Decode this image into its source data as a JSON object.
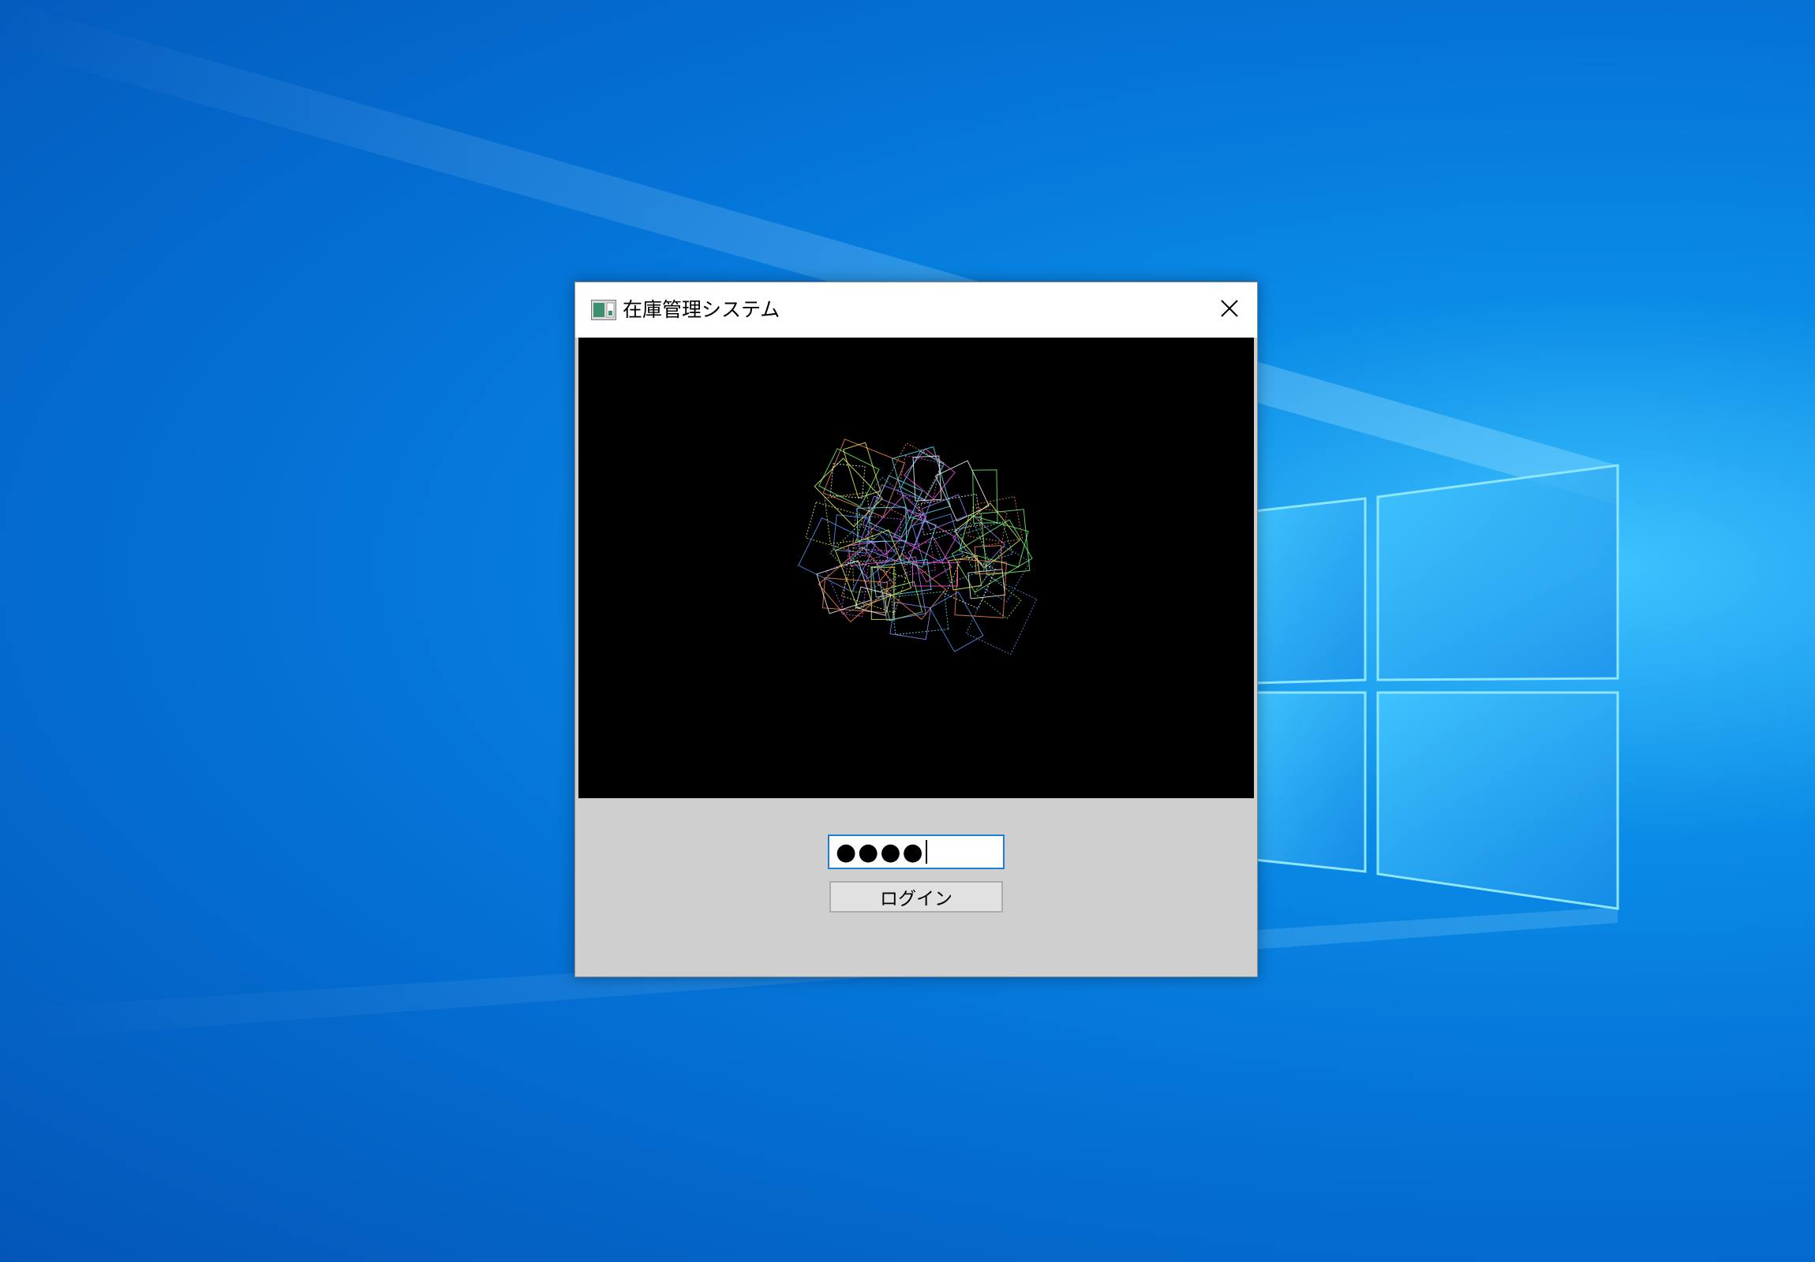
{
  "window": {
    "title": "在庫管理システム",
    "icon": "application-icon",
    "close_icon": "close-icon"
  },
  "login": {
    "password_masked": "●●●●",
    "button_label": "ログイン"
  },
  "colors": {
    "desktop_accent": "#0a8be6",
    "window_background": "#cfcfcf",
    "canvas_background": "#000000",
    "input_focus_border": "#1e7fd9"
  }
}
